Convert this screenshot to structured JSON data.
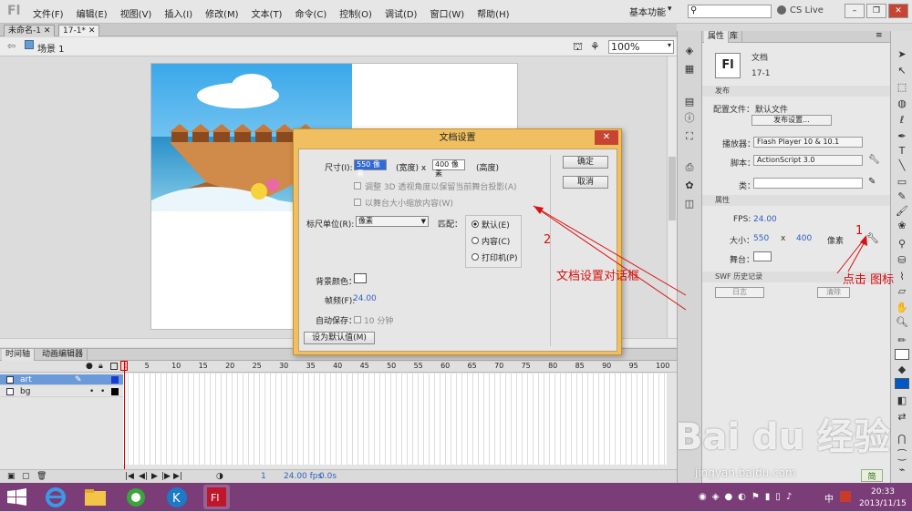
{
  "app": {
    "logo": "Fl"
  },
  "menu": {
    "items": [
      "文件(F)",
      "编辑(E)",
      "视图(V)",
      "插入(I)",
      "修改(M)",
      "文本(T)",
      "命令(C)",
      "控制(O)",
      "调试(D)",
      "窗口(W)",
      "帮助(H)"
    ],
    "workspace": "基本功能",
    "cslive": "CS Live"
  },
  "tabs": {
    "tab1": "未命名-1",
    "tab2": "17-1*"
  },
  "editbar": {
    "scene": "场景 1",
    "zoom": "100%"
  },
  "timeline": {
    "tab_timeline": "时间轴",
    "tab_motion": "动画编辑器",
    "frame_numbers": [
      "1",
      "5",
      "10",
      "15",
      "20",
      "25",
      "30",
      "35",
      "40",
      "45",
      "50",
      "55",
      "60",
      "65",
      "70",
      "75",
      "80",
      "85",
      "90",
      "95",
      "100"
    ],
    "layers": [
      {
        "name": "art"
      },
      {
        "name": "bg"
      }
    ],
    "footer": {
      "frame": "1",
      "fps": "24.00 fps",
      "time": "0.0s"
    }
  },
  "properties": {
    "tab_props": "属性",
    "tab_library": "库",
    "doc_type": "文档",
    "doc_name": "17-1",
    "icon_label": "Fl",
    "section_publish": "发布",
    "profile_label": "配置文件：",
    "profile_value": "默认文件",
    "publish_settings_btn": "发布设置...",
    "player_label": "播放器：",
    "player_value": "Flash Player 10 & 10.1",
    "script_label": "脚本：",
    "script_value": "ActionScript 3.0",
    "class_label": "类：",
    "section_props": "属性",
    "fps_label": "FPS:",
    "fps_value": "24.00",
    "size_label": "大小：",
    "width": "550",
    "x": "x",
    "height": "400",
    "unit": "像素",
    "stage_label": "舞台：",
    "section_swf": "SWF 历史记录",
    "log_btn": "日志",
    "clear_btn": "清除"
  },
  "dialog": {
    "title": "文档设置",
    "size_label": "尺寸(I):",
    "width_value": "550 像素",
    "width_suffix": "(宽度) x",
    "height_value": "400 像素",
    "height_suffix": "(高度)",
    "adjust3d": "调整 3D 透视角度以保留当前舞台投影(A)",
    "scale_content": "以舞台大小缩放内容(W)",
    "ruler_label": "标尺单位(R):",
    "ruler_value": "像素",
    "match_label": "匹配：",
    "match_default": "默认(E)",
    "match_content": "内容(C)",
    "match_printer": "打印机(P)",
    "bg_label": "背景颜色：",
    "fps_label": "帧频(F):",
    "fps_value": "24.00",
    "autosave_label": "自动保存：",
    "autosave_value": "10 分钟",
    "make_default": "设为默认值(M)",
    "ok": "确定",
    "cancel": "取消"
  },
  "annotations": {
    "num1": "1",
    "num2": "2",
    "dialog_note": "文档设置对话框",
    "click_note": "点击  图标"
  },
  "watermark": {
    "brand": "Bai du 经验",
    "url": "jingyan.baidu.com",
    "small_label": "简"
  },
  "taskbar": {
    "time": "20:33",
    "date": "2013/11/15",
    "ime": "中"
  }
}
